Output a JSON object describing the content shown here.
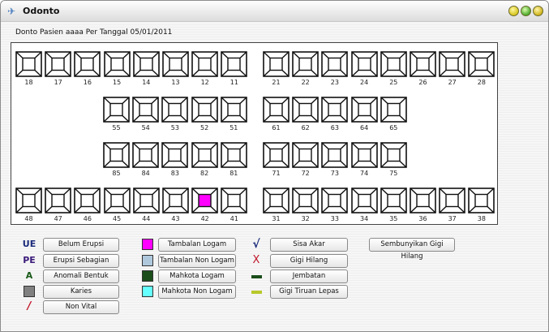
{
  "window": {
    "title": "Odonto"
  },
  "heading": "Donto Pasien aaaa Per Tanggal 05/01/2011",
  "colors": {
    "filled": "#ff00ff",
    "karies": "#808080",
    "non_logam": "#b0c8dc",
    "mahkota_logam": "#1a4d1a",
    "mahkota_non_logam": "#66ffff",
    "jembatan": "#1a4d1a",
    "gigi_tiruan": "#b8c82a",
    "ue": "#1a2a7a",
    "pe": "#3a1a7a",
    "a": "#1a5a1a",
    "nonvital": "#c0182a",
    "sisa": "#1a2a7a",
    "hilang": "#c0182a"
  },
  "teeth_rows": [
    [
      "18",
      "17",
      "16",
      "15",
      "14",
      "13",
      "12",
      "11",
      "21",
      "22",
      "23",
      "24",
      "25",
      "26",
      "27",
      "28"
    ],
    [
      "55",
      "54",
      "53",
      "52",
      "51",
      "61",
      "62",
      "63",
      "64",
      "65"
    ],
    [
      "85",
      "84",
      "83",
      "82",
      "81",
      "71",
      "72",
      "73",
      "74",
      "75"
    ],
    [
      "48",
      "47",
      "46",
      "45",
      "44",
      "43",
      "42",
      "41",
      "31",
      "32",
      "33",
      "34",
      "35",
      "36",
      "37",
      "38"
    ]
  ],
  "filled_teeth": [
    "42"
  ],
  "legend": {
    "col1": [
      {
        "symbol": "UE",
        "label": "Belum Erupsi"
      },
      {
        "symbol": "PE",
        "label": "Erupsi Sebagian"
      },
      {
        "symbol": "A",
        "label": "Anomali Bentuk"
      },
      {
        "symbol": "",
        "label": "Karies"
      },
      {
        "symbol": "/",
        "label": "Non Vital"
      }
    ],
    "col2": [
      {
        "label": "Tambalan Logam"
      },
      {
        "label": "Tambalan Non Logam"
      },
      {
        "label": "Mahkota Logam"
      },
      {
        "label": "Mahkota Non Logam"
      }
    ],
    "col3": [
      {
        "symbol": "√",
        "label": "Sisa Akar"
      },
      {
        "symbol": "X",
        "label": "Gigi Hilang"
      },
      {
        "symbol": "",
        "label": "Jembatan"
      },
      {
        "symbol": "",
        "label": "Gigi Tiruan Lepas"
      }
    ],
    "hide_button": "Sembunyikan Gigi Hilang"
  }
}
